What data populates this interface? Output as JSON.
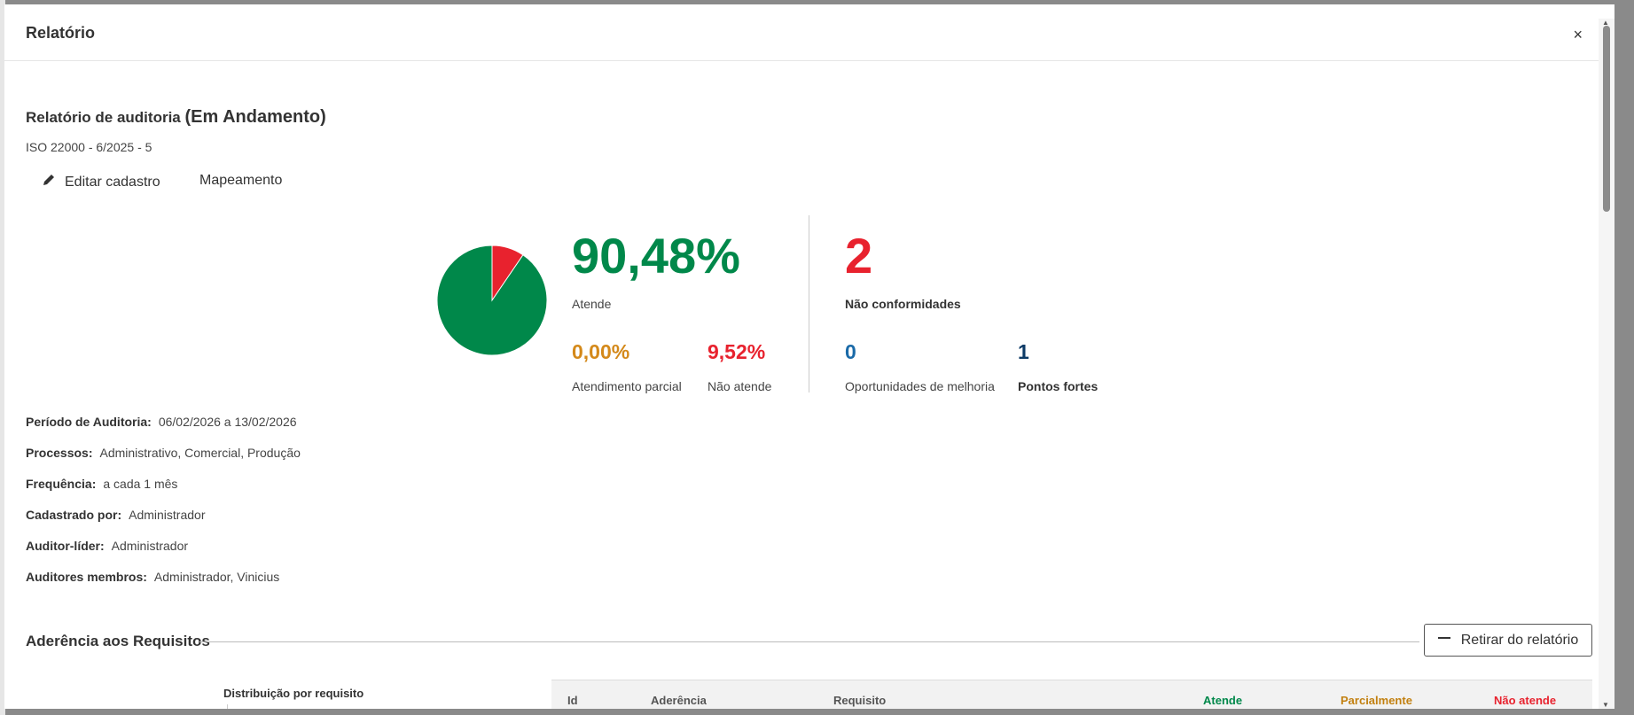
{
  "modal": {
    "title": "Relatório",
    "close_label": "×"
  },
  "report": {
    "title": "Relatório de auditoria",
    "status": "(Em Andamento)",
    "subtitle": "ISO 22000 - 6/2025 - 5"
  },
  "actions": {
    "edit_label": "Editar cadastro",
    "mapping_label": "Mapeamento"
  },
  "summary": {
    "atende_value": "90,48%",
    "atende_label": "Atende",
    "parcial_value": "0,00%",
    "parcial_label": "Atendimento parcial",
    "nao_atende_value": "9,52%",
    "nao_atende_label": "Não atende",
    "nc_value": "2",
    "nc_label": "Não conformidades",
    "om_value": "0",
    "om_label": "Oportunidades de melhoria",
    "pf_value": "1",
    "pf_label": "Pontos fortes",
    "pie": {
      "atende_pct": 90.48,
      "parcial_pct": 0.0,
      "nao_atende_pct": 9.52
    },
    "colors": {
      "atende": "#00884a",
      "parcial": "#d4891a",
      "nao_atende": "#e8222e",
      "blue": "#1a6aa8",
      "navy": "#0d3b66"
    }
  },
  "details": [
    {
      "label": "Período de Auditoria:",
      "value": "06/02/2026 a 13/02/2026"
    },
    {
      "label": "Processos:",
      "value": "Administrativo, Comercial, Produção"
    },
    {
      "label": "Frequência:",
      "value": "a cada 1 mês"
    },
    {
      "label": "Cadastrado por:",
      "value": "Administrador"
    },
    {
      "label": "Auditor-líder:",
      "value": "Administrador"
    },
    {
      "label": "Auditores membros:",
      "value": "Administrador, Vinicius"
    }
  ],
  "adherence": {
    "title": "Aderência aos Requisitos",
    "remove_label": "Retirar do relatório",
    "distribution_label": "Distribuição por requisito",
    "columns": [
      "Id",
      "Aderência",
      "Requisito",
      "Atende",
      "Parcialmente",
      "Não atende"
    ]
  }
}
